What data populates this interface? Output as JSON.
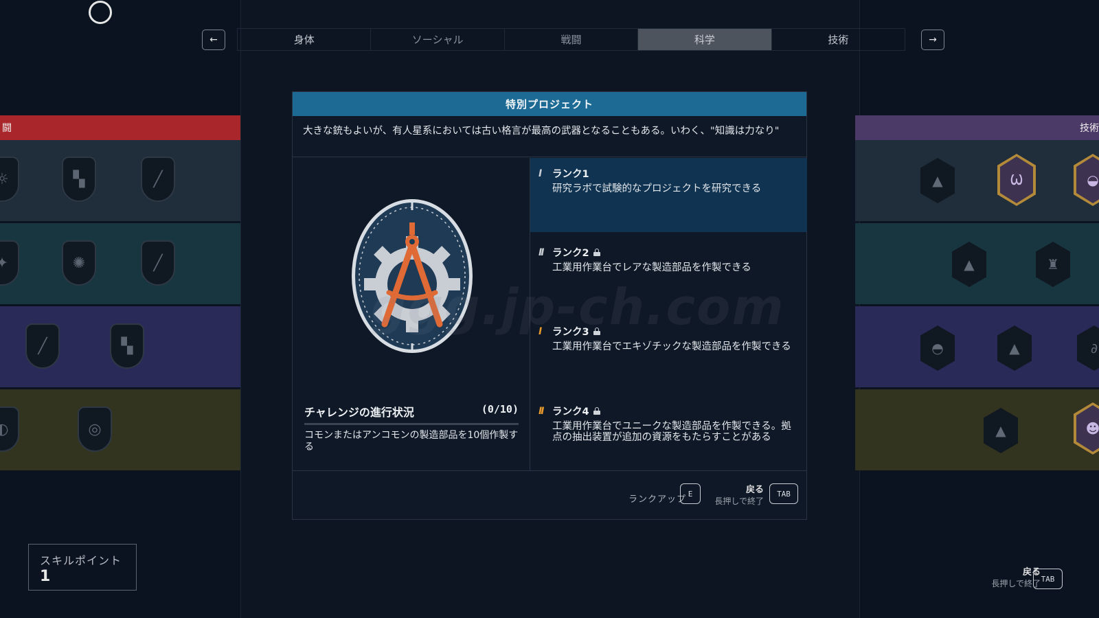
{
  "tabs": [
    {
      "label": "身体",
      "active": false
    },
    {
      "label": "ソーシャル",
      "active": false
    },
    {
      "label": "戦闘",
      "active": false
    },
    {
      "label": "科学",
      "active": true
    },
    {
      "label": "技術",
      "active": false
    }
  ],
  "nav": {
    "prev_icon": "arrow-left-icon",
    "next_icon": "arrow-right-icon"
  },
  "left_category": {
    "label": "闘",
    "color": "#a9262b"
  },
  "right_category": {
    "label": "技術",
    "color": "#4b3a68"
  },
  "modal": {
    "title": "特別プロジェクト",
    "description": "大きな銃もよいが、有人星系においては古い格言が最高の武器となることもある。いわく、\"知識は力なり\"",
    "emblem_icon": "compass-gear-icon",
    "challenge": {
      "title": "チャレンジの進行状況",
      "count": "(0/10)",
      "progress": 0,
      "description": "コモンまたはアンコモンの製造部品を10個作製する"
    },
    "ranks": [
      {
        "bars": "I",
        "label": "ランク1",
        "locked": false,
        "active": true,
        "bar_color": "#c9ced5",
        "text": "研究ラボで試験的なプロジェクトを研究できる"
      },
      {
        "bars": "II",
        "label": "ランク2",
        "locked": true,
        "active": false,
        "bar_color": "#c9ced5",
        "text": "工業用作業台でレアな製造部品を作製できる"
      },
      {
        "bars": "I",
        "label": "ランク3",
        "locked": true,
        "active": false,
        "bar_color": "#e59a2b",
        "text": "工業用作業台でエキゾチックな製造部品を作製できる"
      },
      {
        "bars": "II",
        "label": "ランク4",
        "locked": true,
        "active": false,
        "bar_color": "#e59a2b",
        "text": "工業用作業台でユニークな製造部品を作製できる。拠点の抽出装置が追加の資源をもたらすことがある"
      }
    ],
    "footer": {
      "rankup_label": "ランクアップ",
      "rankup_key": "E",
      "back_label": "戻る",
      "back_hint": "長押しで終了",
      "back_key": "TAB"
    }
  },
  "skill_points": {
    "label": "スキルポイント",
    "value": "1"
  },
  "bottom_back": {
    "label": "戻る",
    "hint": "長押しで終了",
    "key": "TAB"
  },
  "watermark": "ggg.jp-ch.com",
  "colors": {
    "band1": "#1f2e3a",
    "band2": "#183640",
    "band3": "#2a2a58",
    "band4": "#33341f",
    "title_bar": "#1d6a95",
    "active_rank": "#0f3350"
  }
}
